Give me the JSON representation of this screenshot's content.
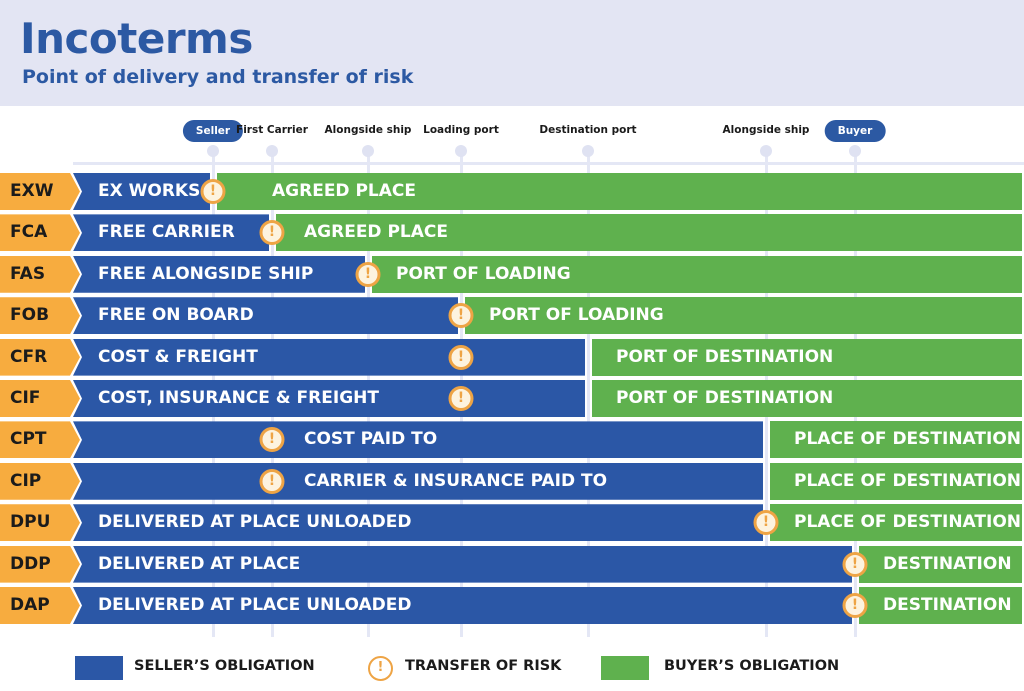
{
  "header": {
    "title": "Incoterms",
    "subtitle": "Point of delivery and transfer of risk"
  },
  "colors": {
    "seller": "#2b57a6",
    "buyer": "#5fb14e",
    "code_tag": "#f7ac3f",
    "risk": "#eea445",
    "header_bg": "#e3e5f3"
  },
  "timeline": {
    "markers": [
      {
        "id": "seller",
        "label": "Seller",
        "style": "pill"
      },
      {
        "id": "first-carrier",
        "label": "First Carrier",
        "style": "text"
      },
      {
        "id": "alongside-ship-origin",
        "label": "Alongside ship",
        "style": "text"
      },
      {
        "id": "loading-port",
        "label": "Loading port",
        "style": "text"
      },
      {
        "id": "destination-port",
        "label": "Destination port",
        "style": "text"
      },
      {
        "id": "alongside-ship-destination",
        "label": "Alongside ship",
        "style": "text"
      },
      {
        "id": "buyer",
        "label": "Buyer",
        "style": "pill"
      }
    ]
  },
  "terms": [
    {
      "code": "EXW",
      "seller_text": "EX WORKS",
      "buyer_text": "AGREED PLACE",
      "seller_end": "seller",
      "risk_at": "seller",
      "buyer_align": "left"
    },
    {
      "code": "FCA",
      "seller_text": "FREE CARRIER",
      "buyer_text": "AGREED PLACE",
      "seller_end": "first-carrier",
      "risk_at": "first-carrier",
      "buyer_align": "left"
    },
    {
      "code": "FAS",
      "seller_text": "FREE ALONGSIDE SHIP",
      "buyer_text": "PORT OF LOADING",
      "seller_end": "alongside-ship-origin",
      "risk_at": "alongside-ship-origin",
      "buyer_align": "left"
    },
    {
      "code": "FOB",
      "seller_text": "FREE ON BOARD",
      "buyer_text": "PORT OF LOADING",
      "seller_end": "loading-port",
      "risk_at": "loading-port",
      "buyer_align": "left"
    },
    {
      "code": "CFR",
      "seller_text": "COST & FREIGHT",
      "buyer_text": "PORT OF DESTINATION",
      "seller_end": "destination-port",
      "risk_at": "loading-port",
      "buyer_align": "left"
    },
    {
      "code": "CIF",
      "seller_text": "COST, INSURANCE & FREIGHT",
      "buyer_text": "PORT OF DESTINATION",
      "seller_end": "destination-port",
      "risk_at": "loading-port",
      "buyer_align": "left"
    },
    {
      "code": "CPT",
      "seller_text": "COST PAID TO",
      "buyer_text": "PLACE OF DESTINATION",
      "seller_end": "alongside-ship-destination",
      "risk_at": "first-carrier",
      "buyer_align": "left",
      "seller_text_after_risk": true
    },
    {
      "code": "CIP",
      "seller_text": "CARRIER & INSURANCE PAID TO",
      "buyer_text": "PLACE OF DESTINATION",
      "seller_end": "alongside-ship-destination",
      "risk_at": "first-carrier",
      "buyer_align": "left",
      "seller_text_after_risk": true
    },
    {
      "code": "DPU",
      "seller_text": "DELIVERED AT PLACE UNLOADED",
      "buyer_text": "PLACE OF DESTINATION",
      "seller_end": "alongside-ship-destination",
      "risk_at": "alongside-ship-destination",
      "buyer_align": "left"
    },
    {
      "code": "DDP",
      "seller_text": "DELIVERED AT PLACE",
      "buyer_text": "DESTINATION",
      "seller_end": "buyer",
      "risk_at": "buyer",
      "buyer_align": "left"
    },
    {
      "code": "DAP",
      "seller_text": "DELIVERED AT PLACE UNLOADED",
      "buyer_text": "DESTINATION",
      "seller_end": "buyer",
      "risk_at": "buyer",
      "buyer_align": "left"
    }
  ],
  "risk_icon_glyph": "!",
  "legend": {
    "seller_label": "SELLER’S OBLIGATION",
    "risk_label": "TRANSFER OF RISK",
    "buyer_label": "BUYER’S OBLIGATION"
  }
}
